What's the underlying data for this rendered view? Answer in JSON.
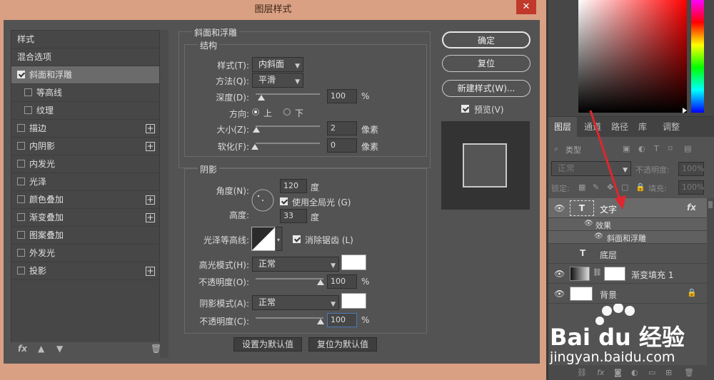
{
  "dialog": {
    "title": "图层样式",
    "close_icon": "close-icon"
  },
  "style_list": {
    "items": [
      {
        "label": "样式",
        "checkbox": false,
        "checked": false,
        "plus": false,
        "selected": false,
        "sub": false
      },
      {
        "label": "混合选项",
        "checkbox": false,
        "checked": false,
        "plus": false,
        "selected": false,
        "sub": false
      },
      {
        "label": "斜面和浮雕",
        "checkbox": true,
        "checked": true,
        "plus": false,
        "selected": true,
        "sub": false
      },
      {
        "label": "等高线",
        "checkbox": true,
        "checked": false,
        "plus": false,
        "selected": false,
        "sub": true
      },
      {
        "label": "纹理",
        "checkbox": true,
        "checked": false,
        "plus": false,
        "selected": false,
        "sub": true
      },
      {
        "label": "描边",
        "checkbox": true,
        "checked": false,
        "plus": true,
        "selected": false,
        "sub": false
      },
      {
        "label": "内阴影",
        "checkbox": true,
        "checked": false,
        "plus": true,
        "selected": false,
        "sub": false
      },
      {
        "label": "内发光",
        "checkbox": true,
        "checked": false,
        "plus": false,
        "selected": false,
        "sub": false
      },
      {
        "label": "光泽",
        "checkbox": true,
        "checked": false,
        "plus": false,
        "selected": false,
        "sub": false
      },
      {
        "label": "颜色叠加",
        "checkbox": true,
        "checked": false,
        "plus": true,
        "selected": false,
        "sub": false
      },
      {
        "label": "渐变叠加",
        "checkbox": true,
        "checked": false,
        "plus": true,
        "selected": false,
        "sub": false
      },
      {
        "label": "图案叠加",
        "checkbox": true,
        "checked": false,
        "plus": false,
        "selected": false,
        "sub": false
      },
      {
        "label": "外发光",
        "checkbox": true,
        "checked": false,
        "plus": false,
        "selected": false,
        "sub": false
      },
      {
        "label": "投影",
        "checkbox": true,
        "checked": false,
        "plus": true,
        "selected": false,
        "sub": false
      }
    ],
    "footer": {
      "fx": "fx",
      "up_icon": "arrow-up-icon",
      "down_icon": "arrow-down-icon",
      "trash_icon": "trash-icon"
    }
  },
  "bevel": {
    "section_title": "斜面和浮雕",
    "structure_title": "结构",
    "style_label": "样式(T):",
    "style_value": "内斜面",
    "technique_label": "方法(Q):",
    "technique_value": "平滑",
    "depth_label": "深度(D):",
    "depth_value": "100",
    "depth_unit": "%",
    "direction_label": "方向:",
    "direction_up": "上",
    "direction_down": "下",
    "direction_selected": "上",
    "size_label": "大小(Z):",
    "size_value": "2",
    "size_unit": "像素",
    "soften_label": "软化(F):",
    "soften_value": "0",
    "soften_unit": "像素"
  },
  "shading": {
    "title": "阴影",
    "angle_label": "角度(N):",
    "angle_value": "120",
    "angle_unit": "度",
    "global_light_label": "使用全局光 (G)",
    "global_light_checked": true,
    "altitude_label": "高度:",
    "altitude_value": "33",
    "altitude_unit": "度",
    "gloss_label": "光泽等高线:",
    "antialias_label": "消除锯齿 (L)",
    "antialias_checked": true,
    "highlight_mode_label": "高光模式(H):",
    "highlight_mode_value": "正常",
    "highlight_color": "#ffffff",
    "highlight_opacity_label": "不透明度(O):",
    "highlight_opacity_value": "100",
    "highlight_opacity_unit": "%",
    "shadow_mode_label": "阴影模式(A):",
    "shadow_mode_value": "正常",
    "shadow_color": "#ffffff",
    "shadow_opacity_label": "不透明度(C):",
    "shadow_opacity_value": "100",
    "shadow_opacity_unit": "%"
  },
  "bottom_buttons": {
    "set_default": "设置为默认值",
    "reset_default": "复位为默认值"
  },
  "right_buttons": {
    "ok": "确定",
    "reset": "复位",
    "new_style": "新建样式(W)...",
    "preview_label": "预览(V)",
    "preview_checked": true
  },
  "layers_panel": {
    "tabs": [
      "图层",
      "通道",
      "路径",
      "库",
      "调整"
    ],
    "active_tab": "图层",
    "filter_kind": "类型",
    "blend_mode": "正常",
    "opacity_label": "不透明度:",
    "opacity_value": "100%",
    "lock_label": "锁定:",
    "fill_label": "填充:",
    "fill_value": "100%",
    "layers": [
      {
        "name": "文字",
        "type": "text",
        "fx": "fx",
        "selected": true
      },
      {
        "name": "效果",
        "type": "effects-header"
      },
      {
        "name": "斜面和浮雕",
        "type": "effect"
      },
      {
        "name": "底层",
        "type": "text"
      },
      {
        "name": "渐变填充 1",
        "type": "gradient-fill"
      },
      {
        "name": "背景",
        "type": "background",
        "locked": true
      }
    ]
  },
  "watermark": {
    "brand_text": "Bai du 经验",
    "url_text": "jingyan.baidu.com"
  },
  "annotation_color": "#e0262e"
}
